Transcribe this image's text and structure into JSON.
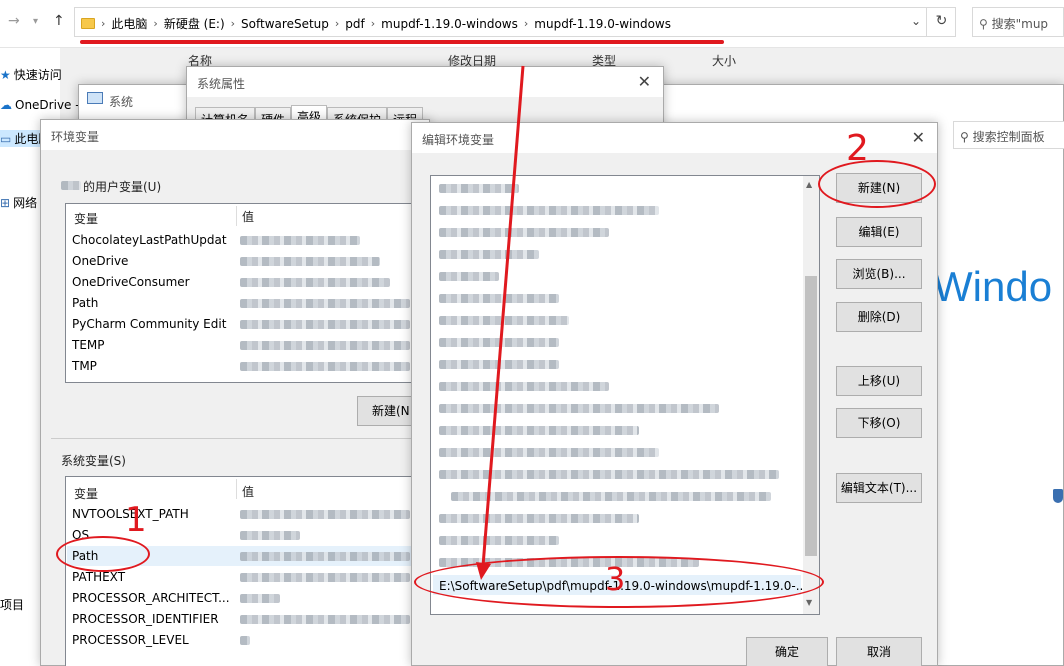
{
  "explorer": {
    "breadcrumbs": [
      "此电脑",
      "新硬盘 (E:)",
      "SoftwareSetup",
      "pdf",
      "mupdf-1.19.0-windows",
      "mupdf-1.19.0-windows"
    ],
    "search_placeholder": "搜索\"mup",
    "columns": [
      "名称",
      "修改日期",
      "类型",
      "大小"
    ]
  },
  "tree": {
    "items": [
      "快速访问",
      "OneDrive -",
      "此电脑",
      "网络",
      "项目"
    ]
  },
  "system_window": {
    "title": "系统",
    "search_placeholder": "搜索控制面板",
    "brand": "Windo"
  },
  "sysprops_window": {
    "title": "系统属性",
    "tabs": [
      "计算机名",
      "硬件",
      "高级",
      "系统保护",
      "远程"
    ]
  },
  "envvars_window": {
    "title": "环境变量",
    "user_section": "的用户变量(U)",
    "system_section": "系统变量(S)",
    "col_var": "变量",
    "col_val": "值",
    "user_vars": [
      "ChocolateyLastPathUpdat",
      "OneDrive",
      "OneDriveConsumer",
      "Path",
      "PyCharm Community Edit",
      "TEMP",
      "TMP"
    ],
    "user_new_button": "新建(N",
    "system_vars": [
      "NVTOOLSEXT_PATH",
      "OS",
      "Path",
      "PATHEXT",
      "PROCESSOR_ARCHITECT...",
      "PROCESSOR_IDENTIFIER",
      "PROCESSOR_LEVEL"
    ]
  },
  "edit_window": {
    "title": "编辑环境变量",
    "buttons": {
      "new": "新建(N)",
      "edit": "编辑(E)",
      "browse": "浏览(B)...",
      "delete": "删除(D)",
      "move_up": "上移(U)",
      "move_down": "下移(O)",
      "edit_text": "编辑文本(T)...",
      "ok": "确定",
      "cancel": "取消"
    },
    "new_entry": "E:\\SoftwareSetup\\pdf\\mupdf-1.19.0-windows\\mupdf-1.19.0-..."
  },
  "annotations": {
    "step1": "1",
    "step2": "2",
    "step3": "3",
    "color": "#e0191f"
  }
}
